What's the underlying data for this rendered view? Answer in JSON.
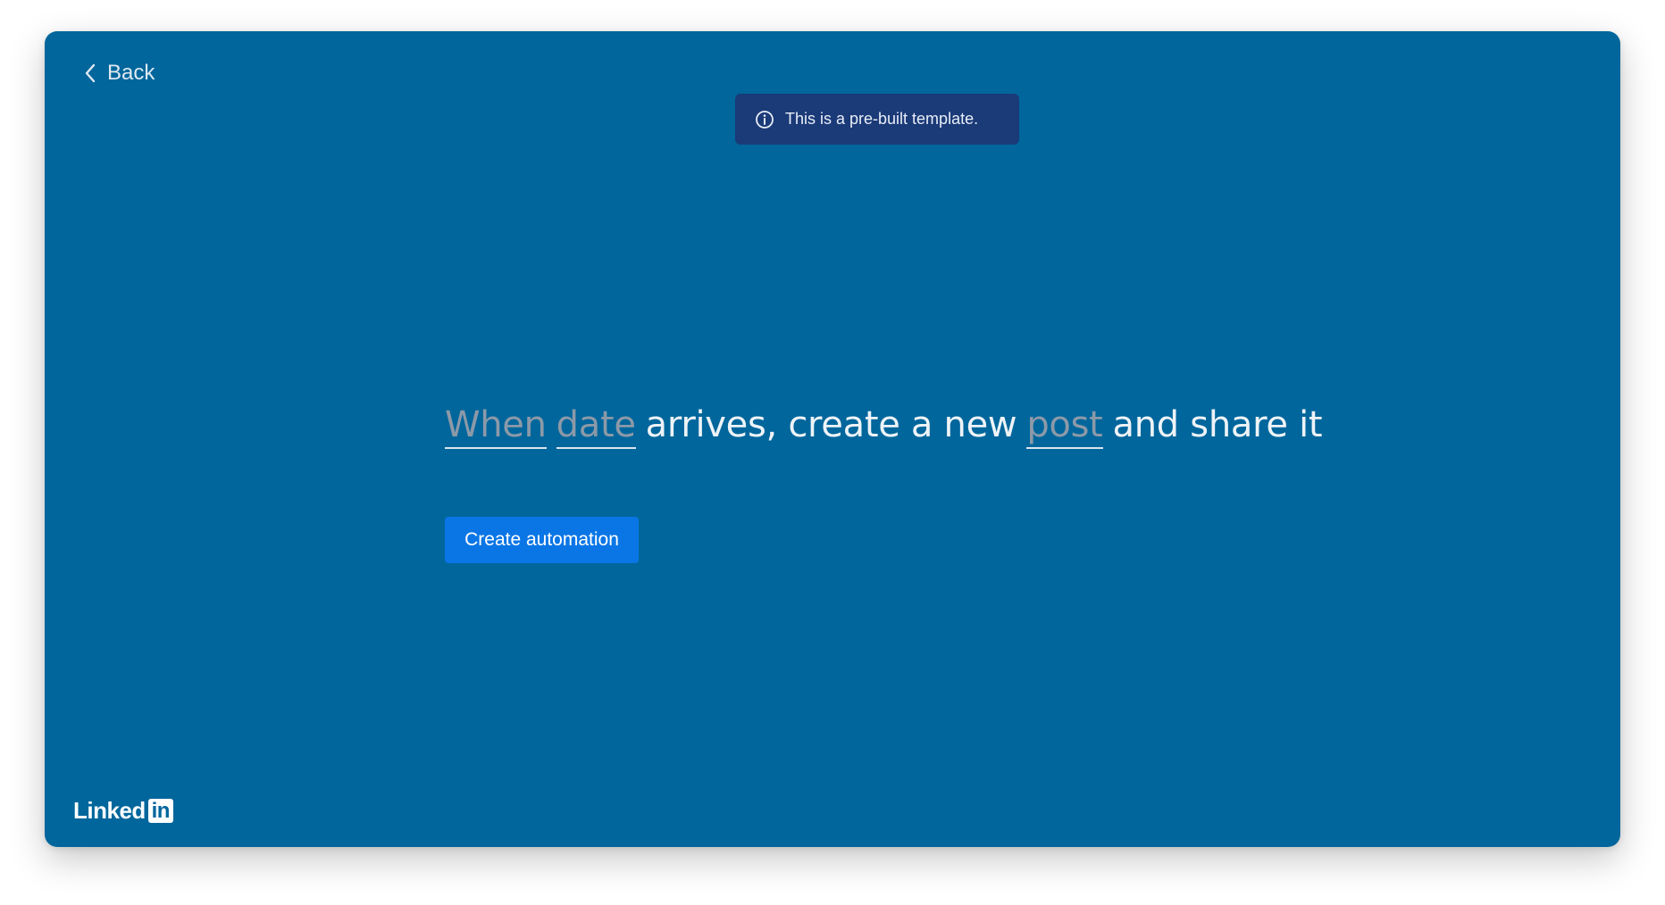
{
  "nav": {
    "back_label": "Back",
    "back_icon": "chevron-left-icon"
  },
  "notice": {
    "icon": "info-icon",
    "text": "This is a pre-built template."
  },
  "recipe": {
    "trigger_word": "When",
    "trigger_field": "date",
    "middle_text": "arrives, create a new",
    "action_field": "post",
    "end_text": "and share it"
  },
  "actions": {
    "create_label": "Create automation"
  },
  "brand": {
    "logo_text": "Linked",
    "logo_box_text": "in"
  },
  "colors": {
    "background": "#00669c",
    "notice": "#1b3a78",
    "button": "#0a76e6",
    "placeholder_token": "#8c99a8"
  }
}
